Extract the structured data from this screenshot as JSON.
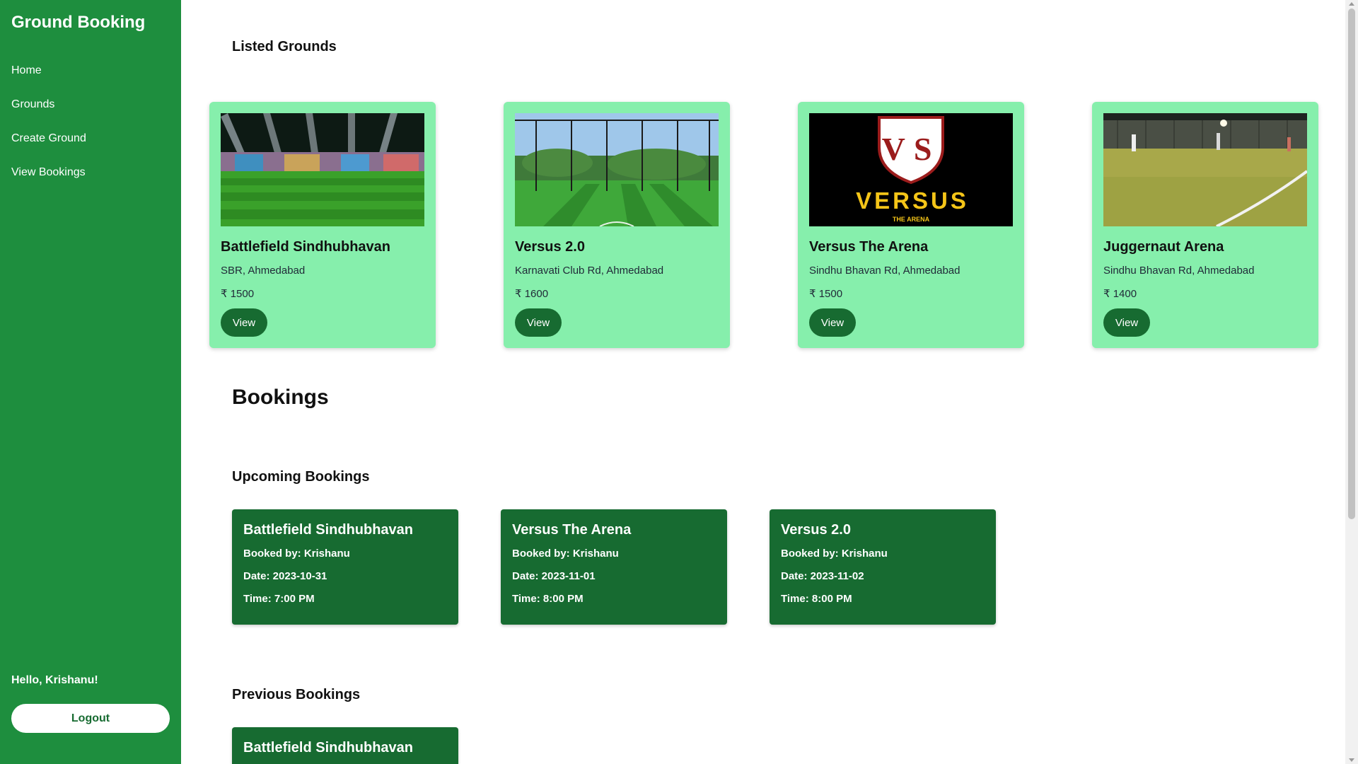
{
  "sidebar": {
    "brand": "Ground Booking",
    "items": [
      {
        "label": "Home"
      },
      {
        "label": "Grounds"
      },
      {
        "label": "Create Ground"
      },
      {
        "label": "View Bookings"
      }
    ],
    "greeting": "Hello, Krishanu!",
    "logout_label": "Logout"
  },
  "listed": {
    "heading": "Listed Grounds",
    "grounds": [
      {
        "name": "Battlefield Sindhubhavan",
        "location": "SBR, Ahmedabad",
        "price": "₹ 1500",
        "view_label": "View",
        "image": "floodlit-turf-photo"
      },
      {
        "name": "Versus 2.0",
        "location": "Karnavati Club Rd, Ahmedabad",
        "price": "₹ 1600",
        "view_label": "View",
        "image": "netted-turf-photo"
      },
      {
        "name": "Versus The Arena",
        "location": "Sindhu Bhavan Rd, Ahmedabad",
        "price": "₹ 1500",
        "view_label": "View",
        "image": "versus-logo",
        "logo_text": "VERSUS",
        "logo_sub": "THE ARENA",
        "logo_letters": "VS"
      },
      {
        "name": "Juggernaut Arena",
        "location": "Sindhu Bhavan Rd, Ahmedabad",
        "price": "₹ 1400",
        "view_label": "View",
        "image": "night-turf-photo"
      }
    ]
  },
  "bookings": {
    "heading": "Bookings",
    "upcoming_heading": "Upcoming Bookings",
    "upcoming": [
      {
        "name": "Battlefield Sindhubhavan",
        "booked_by": "Booked by: Krishanu",
        "date": "Date: 2023-10-31",
        "time": "Time: 7:00 PM"
      },
      {
        "name": "Versus The Arena",
        "booked_by": "Booked by: Krishanu",
        "date": "Date: 2023-11-01",
        "time": "Time: 8:00 PM"
      },
      {
        "name": "Versus 2.0",
        "booked_by": "Booked by: Krishanu",
        "date": "Date: 2023-11-02",
        "time": "Time: 8:00 PM"
      }
    ],
    "previous_heading": "Previous Bookings",
    "previous": [
      {
        "name": "Battlefield Sindhubhavan"
      }
    ]
  },
  "colors": {
    "sidebar": "#1e8e3e",
    "card": "#86efac",
    "button": "#176b31",
    "booking_card": "#176b31"
  }
}
